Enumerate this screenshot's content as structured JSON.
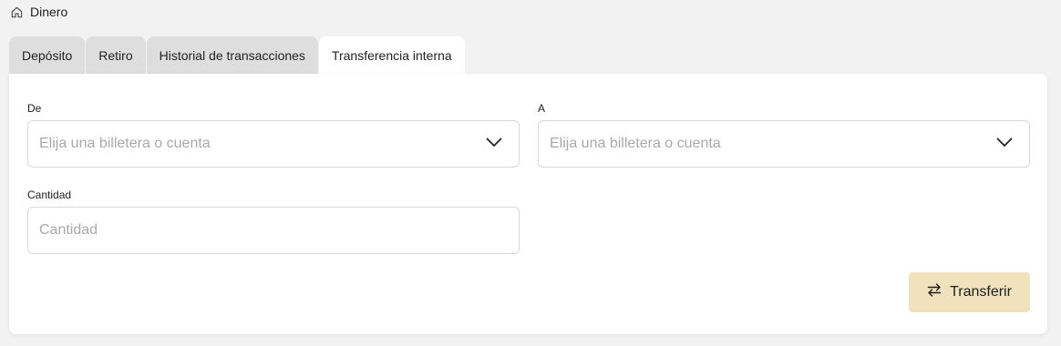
{
  "breadcrumb": {
    "label": "Dinero",
    "icon": "home-icon"
  },
  "tabs": [
    {
      "label": "Depósito",
      "active": false
    },
    {
      "label": "Retiro",
      "active": false
    },
    {
      "label": "Historial de transacciones",
      "active": false
    },
    {
      "label": "Transferencia interna",
      "active": true
    }
  ],
  "form": {
    "from": {
      "label": "De",
      "placeholder": "Elija una billetera o cuenta",
      "icon": "chevron-down-icon"
    },
    "to": {
      "label": "A",
      "placeholder": "Elija una billetera o cuenta",
      "icon": "chevron-down-icon"
    },
    "amount": {
      "label": "Cantidad",
      "placeholder": "Cantidad"
    },
    "submit": {
      "label": "Transferir",
      "icon": "swap-arrows-icon",
      "color": "#efe2bd"
    }
  }
}
